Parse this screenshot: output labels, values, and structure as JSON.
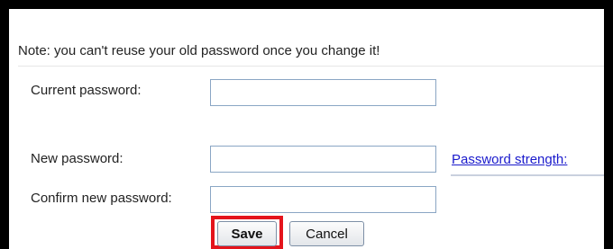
{
  "form": {
    "note": "Note: you can't reuse your old password once you change it!",
    "current_password_label": "Current password:",
    "current_password_value": "",
    "new_password_label": "New password:",
    "new_password_value": "",
    "confirm_password_label": "Confirm new password:",
    "confirm_password_value": "",
    "password_strength_link": "Password strength:",
    "save_label": "Save",
    "cancel_label": "Cancel"
  },
  "colors": {
    "highlight": "#e4141c",
    "link": "#1a1acc"
  }
}
